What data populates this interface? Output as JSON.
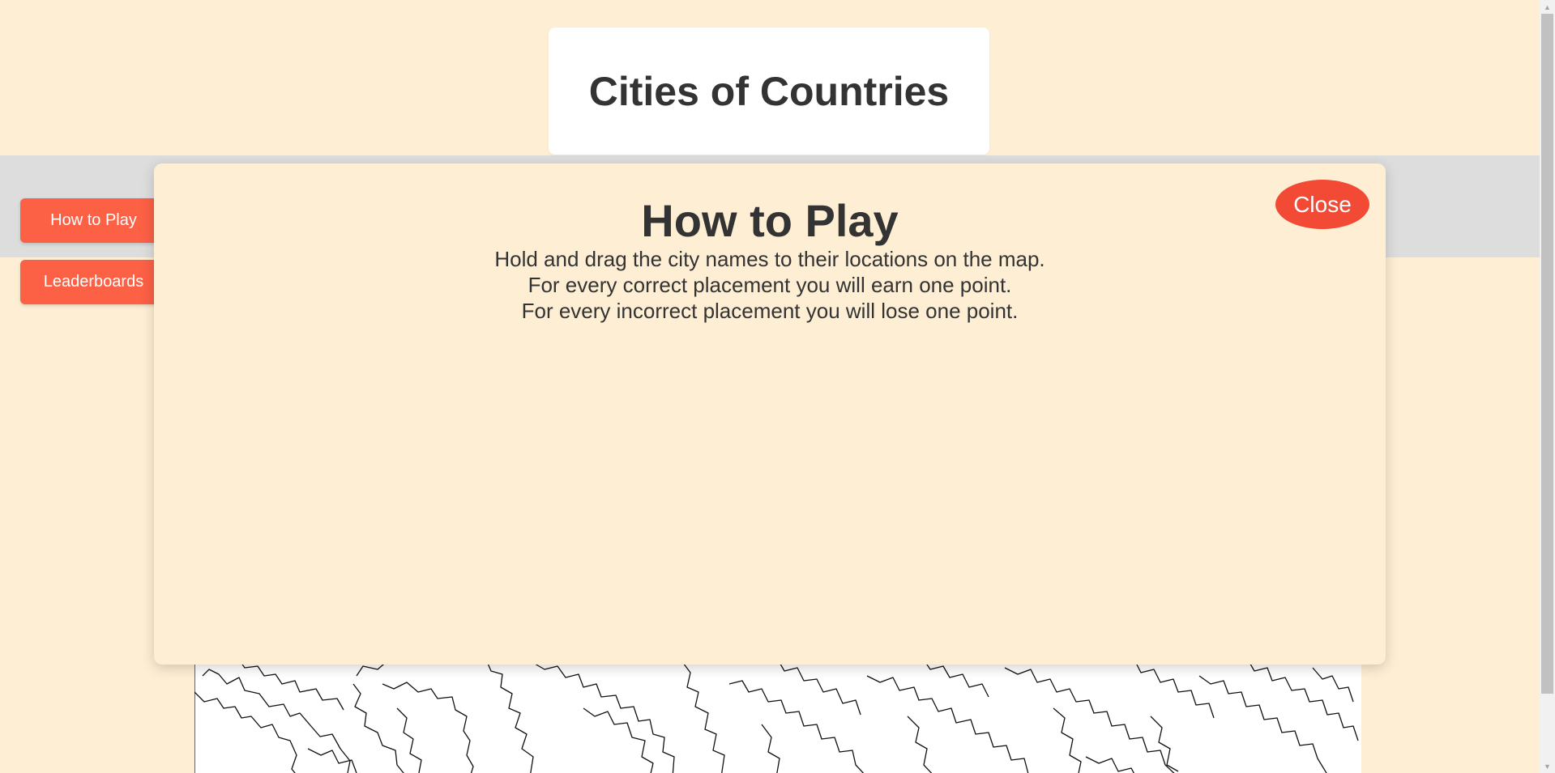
{
  "header": {
    "title": "Cities of Countries"
  },
  "sidebar": {
    "how_to_play_label": "How to Play",
    "leaderboards_label": "Leaderboards"
  },
  "modal": {
    "title": "How to Play",
    "close_label": "Close",
    "instructions": [
      "Hold and drag the city names to their locations on the map.",
      "For every correct placement you will earn one point.",
      "For every incorrect placement you will lose one point."
    ]
  },
  "colors": {
    "background": "#feefd4",
    "button": "#fc6045",
    "close_button": "#f34a36",
    "text": "#333333",
    "band": "#dddddd"
  },
  "icons": {
    "scroll_up": "scroll-up-arrow-icon",
    "scroll_down": "scroll-down-arrow-icon"
  }
}
